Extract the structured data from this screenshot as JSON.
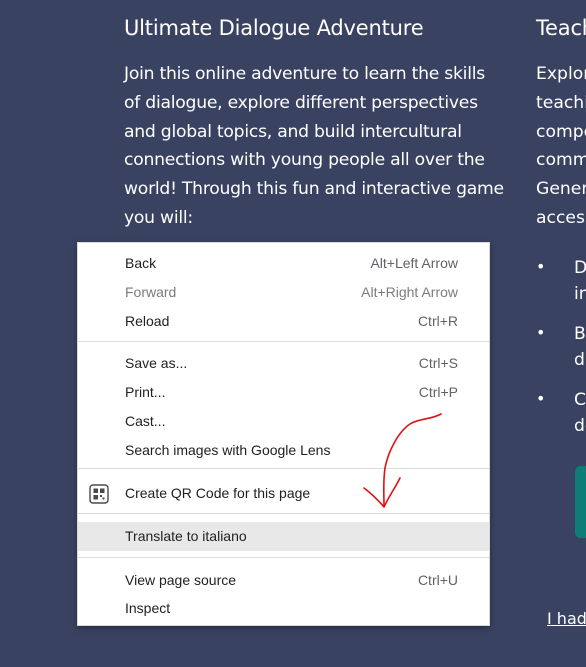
{
  "left_column": {
    "title": "Ultimate Dialogue Adventure",
    "body": "Join this online adventure to learn the skills of dialogue, explore different perspectives and global topics, and build intercultural connections with young people all over the world! Through this fun and interactive game you will:"
  },
  "right_column": {
    "title_partial": "Teach",
    "lines_partial": [
      "Explor",
      "teachi",
      "compe",
      "comm",
      "Gener",
      "access"
    ],
    "bullets_partial": [
      {
        "line1": "D",
        "line2": "in"
      },
      {
        "line1": "B",
        "line2": "di"
      },
      {
        "line1": "C",
        "line2": "de"
      }
    ],
    "link_partial": "I had"
  },
  "context_menu": {
    "items": [
      {
        "label": "Back",
        "shortcut": "Alt+Left Arrow"
      },
      {
        "label": "Forward",
        "shortcut": "Alt+Right Arrow",
        "disabled": true
      },
      {
        "label": "Reload",
        "shortcut": "Ctrl+R"
      },
      {
        "label": "Save as...",
        "shortcut": "Ctrl+S"
      },
      {
        "label": "Print...",
        "shortcut": "Ctrl+P"
      },
      {
        "label": "Cast...",
        "shortcut": ""
      },
      {
        "label": "Search images with Google Lens",
        "shortcut": ""
      },
      {
        "label": "Create QR Code for this page",
        "shortcut": "",
        "icon": "qr-code-icon"
      },
      {
        "label": "Translate to italiano",
        "shortcut": "",
        "highlighted": true
      },
      {
        "label": "View page source",
        "shortcut": "Ctrl+U"
      },
      {
        "label": "Inspect",
        "shortcut": ""
      }
    ]
  },
  "colors": {
    "page_background": "#3a4262",
    "menu_background": "#ffffff",
    "menu_highlight": "#e8e8e8",
    "annotation_red": "#e01010",
    "accent_teal": "#0f7d77"
  }
}
